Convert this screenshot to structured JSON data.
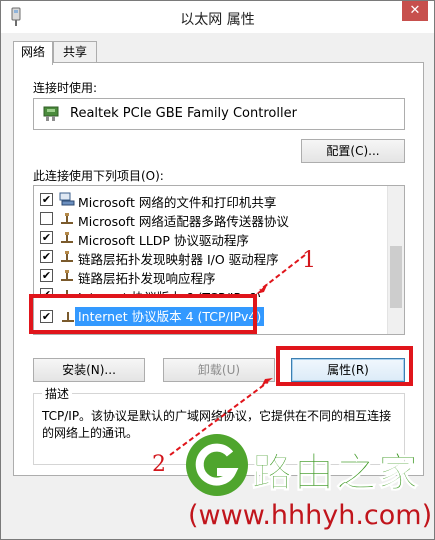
{
  "window": {
    "title": "以太网 属性",
    "close_glyph": "✕"
  },
  "tabs": [
    {
      "label": "网络",
      "active": true
    },
    {
      "label": "共享",
      "active": false
    }
  ],
  "connect_using_label": "连接时使用:",
  "adapter_name": "Realtek PCIe GBE Family Controller",
  "configure_button": "配置(C)...",
  "items_label": "此连接使用下列项目(O):",
  "items": [
    {
      "checked": true,
      "icon": "network-client-icon",
      "label": "Microsoft 网络的文件和打印机共享"
    },
    {
      "checked": false,
      "icon": "protocol-icon",
      "label": "Microsoft 网络适配器多路传送器协议"
    },
    {
      "checked": true,
      "icon": "protocol-icon",
      "label": "Microsoft LLDP 协议驱动程序"
    },
    {
      "checked": true,
      "icon": "protocol-icon",
      "label": "链路层拓扑发现映射器 I/O 驱动程序"
    },
    {
      "checked": true,
      "icon": "protocol-icon",
      "label": "链路层拓扑发现响应程序"
    },
    {
      "checked": true,
      "icon": "protocol-icon",
      "label": "Internet 协议版本 6 (TCP/IPv6)"
    },
    {
      "checked": true,
      "icon": "protocol-icon",
      "label": "Internet 协议版本 4 (TCP/IPv4)",
      "selected": true
    }
  ],
  "checkbox_glyph": "✔",
  "buttons": {
    "install": "安装(N)...",
    "uninstall": "卸载(U)",
    "properties": "属性(R)"
  },
  "description": {
    "title": "描述",
    "text": "TCP/IP。该协议是默认的广域网络协议，它提供在不同的相互连接的网络上的通讯。"
  },
  "annotations": {
    "step1": "1",
    "step2": "2"
  },
  "watermark": {
    "title": "路由之家",
    "url": "www.hhhyh.com"
  },
  "colors": {
    "selection": "#3399ff",
    "annotation_red": "#e0151b",
    "watermark_green": "#3f9a25"
  }
}
